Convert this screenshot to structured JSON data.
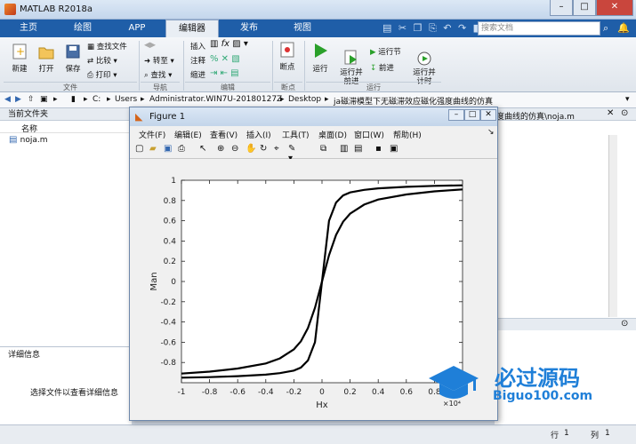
{
  "window": {
    "title": "MATLAB R2018a",
    "controls": [
      "–",
      "□",
      "✕"
    ]
  },
  "tabs": [
    {
      "label": "主页",
      "active": false
    },
    {
      "label": "绘图",
      "active": false
    },
    {
      "label": "APP",
      "active": false
    },
    {
      "label": "编辑器",
      "active": true
    },
    {
      "label": "发布",
      "active": false
    },
    {
      "label": "视图",
      "active": false
    }
  ],
  "search": {
    "placeholder": "搜索文档"
  },
  "ribbon": {
    "file": {
      "new": "新建",
      "open": "打开",
      "save": "保存",
      "find_files": "查找文件",
      "compare": "比较",
      "print": "打印",
      "group": "文件"
    },
    "nav": {
      "goto": "转至",
      "find": "查找",
      "group": "导航"
    },
    "edit": {
      "insert": "插入",
      "comment": "注释",
      "indent": "缩进",
      "fx": "fx",
      "group": "编辑"
    },
    "breakpoints": {
      "label": "断点",
      "group": "断点"
    },
    "run": {
      "run": "运行",
      "run_advance": "运行并\n前进",
      "run_section": "运行节",
      "advance": "前进",
      "run_time": "运行并\n计时",
      "group": "运行"
    }
  },
  "address": {
    "segments": [
      "C:",
      "Users",
      "Administrator.WIN7U-20180127Z",
      "Desktop",
      "ja磁滞模型下无磁滞效应磁化强度曲线的仿真"
    ]
  },
  "left_panel": {
    "title": "当前文件夹",
    "col_name": "名称",
    "files": [
      "noja.m"
    ]
  },
  "details": {
    "title": "详细信息",
    "hint": "选择文件以查看详细信息"
  },
  "editor": {
    "tab_path": "度曲线的仿真\\noja.m"
  },
  "status": {
    "row_label": "行",
    "row": "1",
    "col_label": "列",
    "col": "1"
  },
  "figure": {
    "title": "Figure 1",
    "menu": [
      "文件(F)",
      "编辑(E)",
      "查看(V)",
      "插入(I)",
      "工具(T)",
      "桌面(D)",
      "窗口(W)",
      "帮助(H)"
    ]
  },
  "chart_data": {
    "type": "line",
    "title": "",
    "xlabel": "Hx",
    "ylabel": "Man",
    "x_multiplier": "×10⁴",
    "xlim": [
      -1,
      1
    ],
    "ylim": [
      -1,
      1
    ],
    "xticks": [
      "-1",
      "-0.8",
      "-0.6",
      "-0.4",
      "-0.2",
      "0",
      "0.2",
      "0.4",
      "0.6",
      "0.8",
      "1"
    ],
    "yticks": [
      "1",
      "0.8",
      "0.6",
      "0.4",
      "0.2",
      "0",
      "-0.2",
      "-0.4",
      "-0.6",
      "-0.8"
    ],
    "grid": false,
    "series_color": "#000000",
    "series": [
      {
        "x": [
          -1,
          -0.8,
          -0.6,
          -0.4,
          -0.3,
          -0.2,
          -0.15,
          -0.1,
          -0.05,
          0,
          0.05,
          0.1,
          0.15,
          0.2,
          0.3,
          0.4,
          0.6,
          0.8,
          1
        ],
        "y": [
          -0.91,
          -0.89,
          -0.86,
          -0.81,
          -0.76,
          -0.67,
          -0.59,
          -0.46,
          -0.26,
          0,
          0.26,
          0.46,
          0.59,
          0.67,
          0.76,
          0.81,
          0.86,
          0.89,
          0.91
        ]
      },
      {
        "x": [
          -1,
          -0.8,
          -0.6,
          -0.4,
          -0.3,
          -0.2,
          -0.15,
          -0.1,
          -0.05,
          0,
          0.05,
          0.1,
          0.15,
          0.2,
          0.3,
          0.4,
          0.6,
          0.8,
          1
        ],
        "y": [
          -0.95,
          -0.945,
          -0.935,
          -0.92,
          -0.905,
          -0.88,
          -0.85,
          -0.78,
          -0.6,
          0,
          0.6,
          0.78,
          0.85,
          0.88,
          0.905,
          0.92,
          0.935,
          0.945,
          0.95
        ]
      }
    ]
  },
  "watermark": {
    "brand": "必过源码",
    "site": "Biguo100.com"
  }
}
